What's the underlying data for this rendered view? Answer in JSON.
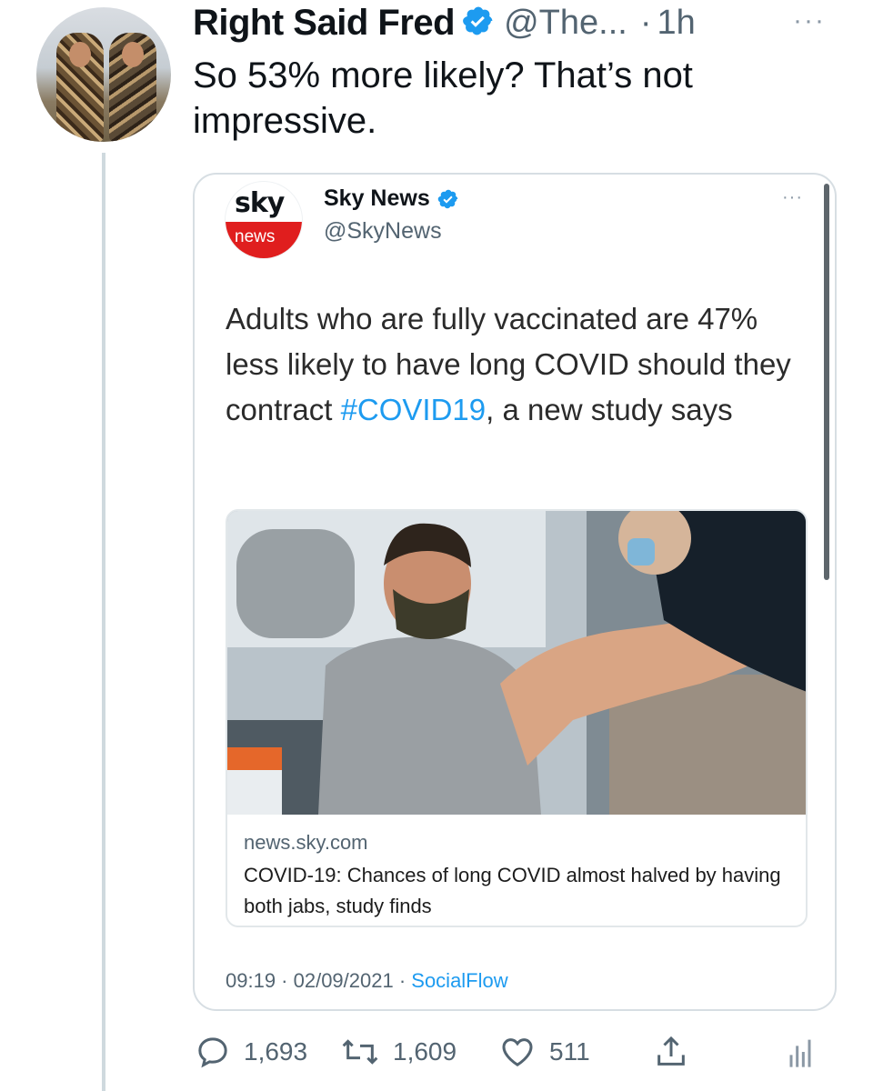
{
  "tweet": {
    "author_name": "Right Said Fred",
    "author_handle": "@The...",
    "separator": "·",
    "time": "1h",
    "more": "···",
    "text": "So 53% more likely? That’s not impressive."
  },
  "quoted_tweet": {
    "logo_top": "sky",
    "logo_bottom": "news",
    "author_name": "Sky News",
    "author_handle": "@SkyNews",
    "more": "···",
    "text_before": "Adults who are fully vaccinated are 47% less likely to have long COVID should they contract ",
    "hashtag": "#COVID19",
    "text_after": ", a new study says",
    "card": {
      "domain": "news.sky.com",
      "title": "COVID-19: Chances of long COVID almost halved by having both jabs, study finds"
    },
    "timestamp": "09:19 · 02/09/2021 · ",
    "source": "SocialFlow"
  },
  "actions": {
    "replies": "1,693",
    "retweets": "1,609",
    "likes": "511"
  },
  "colors": {
    "link": "#1d9bf0",
    "secondary_text": "#536471",
    "border": "#d7dee3",
    "brand_red": "#e01e1e"
  },
  "icons": [
    "verified-badge-icon",
    "reply-icon",
    "retweet-icon",
    "like-icon",
    "share-icon",
    "analytics-icon",
    "more-icon"
  ]
}
